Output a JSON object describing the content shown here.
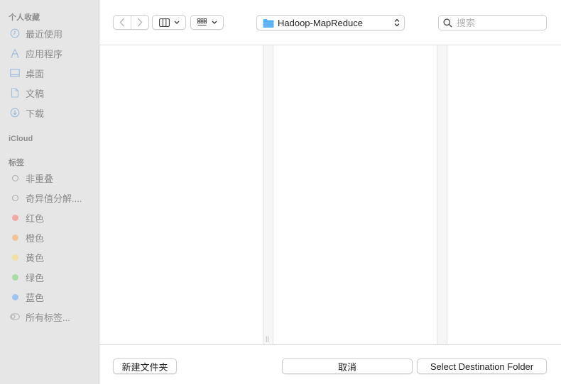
{
  "sidebar": {
    "favorites_header": "个人收藏",
    "favorites": [
      {
        "label": "最近使用",
        "icon": "clock-icon"
      },
      {
        "label": "应用程序",
        "icon": "applications-icon"
      },
      {
        "label": "桌面",
        "icon": "desktop-icon"
      },
      {
        "label": "文稿",
        "icon": "document-icon"
      },
      {
        "label": "下载",
        "icon": "download-icon"
      }
    ],
    "icloud_header": "iCloud",
    "tags_header": "标签",
    "tags": [
      {
        "label": "非重叠",
        "color": ""
      },
      {
        "label": "奇异值分解....",
        "color": ""
      },
      {
        "label": "红色",
        "color": "#f0a9a4"
      },
      {
        "label": "橙色",
        "color": "#f2c398"
      },
      {
        "label": "黄色",
        "color": "#f1e0a0"
      },
      {
        "label": "绿色",
        "color": "#a9dba6"
      },
      {
        "label": "蓝色",
        "color": "#9ec4f2"
      }
    ],
    "all_tags": "所有标签..."
  },
  "toolbar": {
    "back_icon": "chevron-left-icon",
    "forward_icon": "chevron-right-icon",
    "view_icon": "column-view-icon",
    "group_icon": "grid-group-icon",
    "path_folder_icon": "folder-icon",
    "path_label": "Hadoop-MapReduce",
    "search_placeholder": "搜索"
  },
  "footer": {
    "new_folder": "新建文件夹",
    "cancel": "取消",
    "confirm": "Select Destination Folder"
  },
  "colors": {
    "sidebar_bg": "#e6e6e6",
    "folder_blue": "#5eb5f5"
  }
}
